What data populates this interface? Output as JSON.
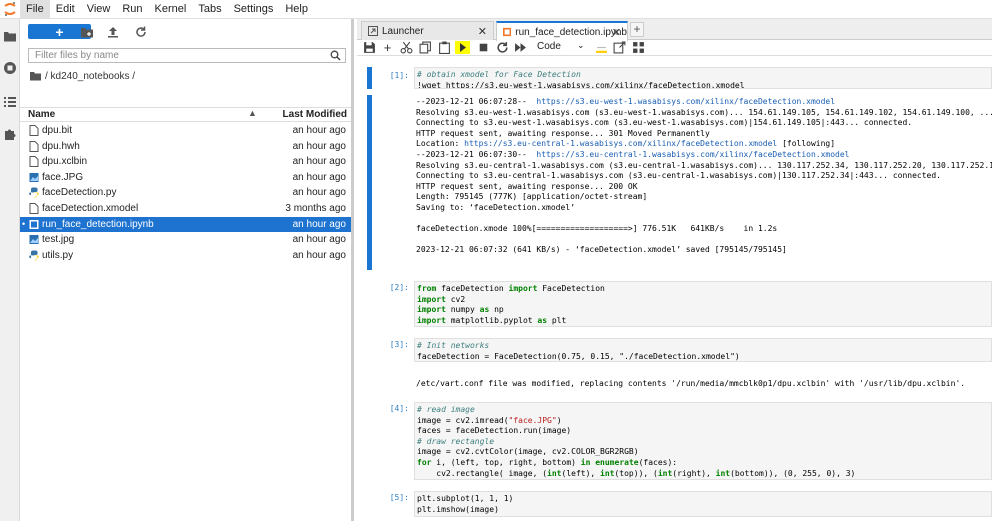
{
  "menubar": {
    "items": [
      "File",
      "Edit",
      "View",
      "Run",
      "Kernel",
      "Tabs",
      "Settings",
      "Help"
    ],
    "active": "File"
  },
  "leftbar": {
    "icons": [
      "folder-icon",
      "running-icon",
      "toc-icon",
      "extension-icon"
    ]
  },
  "filebrowser": {
    "new_label": "+",
    "filter_placeholder": "Filter files by name",
    "breadcrumb": "/ kd240_notebooks /",
    "col_name": "Name",
    "col_modified": "Last Modified",
    "files": [
      {
        "name": "dpu.bit",
        "modified": "an hour ago",
        "icon": "file-icon"
      },
      {
        "name": "dpu.hwh",
        "modified": "an hour ago",
        "icon": "file-icon"
      },
      {
        "name": "dpu.xclbin",
        "modified": "an hour ago",
        "icon": "file-icon"
      },
      {
        "name": "face.JPG",
        "modified": "an hour ago",
        "icon": "image-icon"
      },
      {
        "name": "faceDetection.py",
        "modified": "an hour ago",
        "icon": "python-icon"
      },
      {
        "name": "faceDetection.xmodel",
        "modified": "3 months ago",
        "icon": "file-icon"
      },
      {
        "name": "run_face_detection.ipynb",
        "modified": "an hour ago",
        "icon": "notebook-icon",
        "selected": true
      },
      {
        "name": "test.jpg",
        "modified": "an hour ago",
        "icon": "image-icon"
      },
      {
        "name": "utils.py",
        "modified": "an hour ago",
        "icon": "python-icon"
      }
    ]
  },
  "tabs": [
    {
      "label": "Launcher",
      "active": false
    },
    {
      "label": "run_face_detection.ipynb",
      "active": true
    }
  ],
  "toolbar": {
    "cell_type": "Code"
  },
  "cells": [
    {
      "prompt": "[1]:",
      "input_lines": [
        "# obtain xmodel for Face Detection",
        "!wget https://s3.eu-west-1.wasabisys.com/xilinx/faceDetection.xmodel"
      ],
      "output_lines": [
        "--2023-12-21 06:07:28--  https://s3.eu-west-1.wasabisys.com/xilinx/faceDetection.xmodel",
        "Resolving s3.eu-west-1.wasabisys.com (s3.eu-west-1.wasabisys.com)... 154.61.149.105, 154.61.149.102, 154.61.149.100, ...",
        "Connecting to s3.eu-west-1.wasabisys.com (s3.eu-west-1.wasabisys.com)|154.61.149.105|:443... connected.",
        "HTTP request sent, awaiting response... 301 Moved Permanently",
        "Location: https://s3.eu-central-1.wasabisys.com/xilinx/faceDetection.xmodel [following]",
        "--2023-12-21 06:07:30--  https://s3.eu-central-1.wasabisys.com/xilinx/faceDetection.xmodel",
        "Resolving s3.eu-central-1.wasabisys.com (s3.eu-central-1.wasabisys.com)... 130.117.252.34, 130.117.252.20, 130.117.252.10, ...",
        "Connecting to s3.eu-central-1.wasabisys.com (s3.eu-central-1.wasabisys.com)|130.117.252.34|:443... connected.",
        "HTTP request sent, awaiting response... 200 OK",
        "Length: 795145 (777K) [application/octet-stream]",
        "Saving to: ‘faceDetection.xmodel’",
        "",
        "faceDetection.xmode 100%[===================>] 776.51K   641KB/s    in 1.2s",
        "",
        "2023-12-21 06:07:32 (641 KB/s) - ‘faceDetection.xmodel’ saved [795145/795145]"
      ]
    },
    {
      "prompt": "[2]:",
      "input_lines": [
        "from faceDetection import FaceDetection",
        "import cv2",
        "import numpy as np",
        "import matplotlib.pyplot as plt"
      ]
    },
    {
      "prompt": "[3]:",
      "input_lines": [
        "# Init networks",
        "faceDetection = FaceDetection(0.75, 0.15, \"./faceDetection.xmodel\")"
      ],
      "output_lines": [
        "/etc/vart.conf file was modified, replacing contents '/run/media/mmcblk0p1/dpu.xclbin' with '/usr/lib/dpu.xclbin'."
      ]
    },
    {
      "prompt": "[4]:",
      "input_lines": [
        "# read image",
        "image = cv2.imread(\"face.JPG\")",
        "faces = faceDetection.run(image)",
        "# draw rectangle",
        "image = cv2.cvtColor(image, cv2.COLOR_BGR2RGB)",
        "for i, (left, top, right, bottom) in enumerate(faces):",
        "    cv2.rectangle( image, (int(left), int(top)), (int(right), int(bottom)), (0, 255, 0), 3)"
      ]
    },
    {
      "prompt": "[5]:",
      "input_lines": [
        "plt.subplot(1, 1, 1)",
        "plt.imshow(image)"
      ]
    }
  ]
}
